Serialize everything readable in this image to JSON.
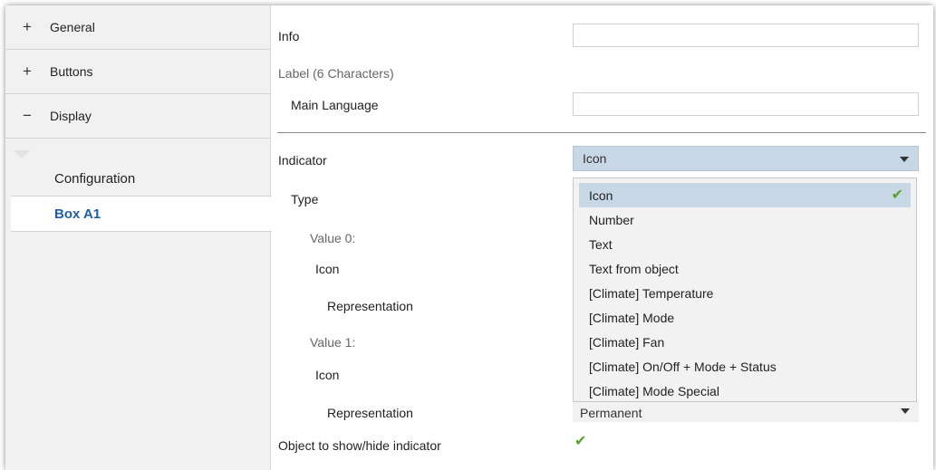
{
  "sidebar": {
    "categories": [
      {
        "symbol": "+",
        "label": "General"
      },
      {
        "symbol": "+",
        "label": "Buttons"
      },
      {
        "symbol": "−",
        "label": "Display"
      }
    ],
    "subitems": [
      {
        "label": "Configuration"
      },
      {
        "label": "Box A1"
      }
    ]
  },
  "main": {
    "info_label": "Info",
    "info_value": "",
    "label_section": "Label (6 Characters)",
    "main_language_label": "Main Language",
    "main_language_value": "",
    "indicator_label": "Indicator",
    "indicator_value": "Icon",
    "type_label": "Type",
    "value0_label": "Value 0:",
    "icon0_label": "Icon",
    "representation0_label": "Representation",
    "value1_label": "Value 1:",
    "icon1_label": "Icon",
    "representation1_label": "Representation",
    "representation1_value": "Permanent",
    "object_label": "Object to show/hide indicator",
    "object_checked": "✔"
  },
  "dropdown": {
    "options": [
      {
        "label": "Icon",
        "check": "✔"
      },
      {
        "label": "Number"
      },
      {
        "label": "Text"
      },
      {
        "label": "Text from object"
      },
      {
        "label": "[Climate] Temperature"
      },
      {
        "label": "[Climate] Mode"
      },
      {
        "label": "[Climate] Fan"
      },
      {
        "label": "[Climate] On/Off + Mode + Status"
      },
      {
        "label": "[Climate] Mode Special"
      }
    ]
  },
  "colors": {
    "selected_bg": "#c8d7e6",
    "accent_text": "#1f5fa8",
    "check": "#5aa02c",
    "sidebar_bg": "#f1f1f1"
  }
}
